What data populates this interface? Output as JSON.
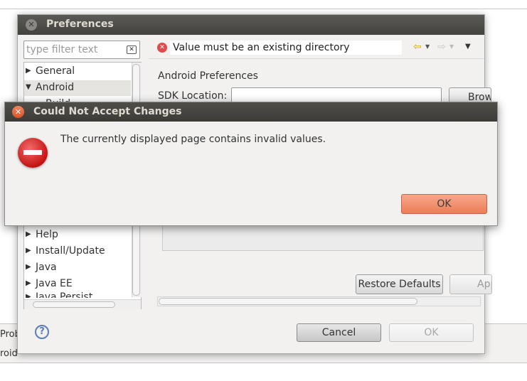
{
  "background": {
    "bottom_tab_1": "Prob",
    "bottom_tab_2": "roid"
  },
  "preferences": {
    "title": "Preferences",
    "filter_placeholder": "type filter text",
    "tree": [
      {
        "label": "General",
        "expanded": false
      },
      {
        "label": "Android",
        "expanded": true,
        "selected": true
      },
      {
        "label": "Build",
        "expanded": false
      },
      {
        "label": "Help",
        "expanded": false
      },
      {
        "label": "Install/Update",
        "expanded": false
      },
      {
        "label": "Java",
        "expanded": false
      },
      {
        "label": "Java EE",
        "expanded": false
      },
      {
        "label": "Java Persist",
        "expanded": false
      }
    ],
    "message": "Value must be an existing directory",
    "page_title": "Android Preferences",
    "sdk_location_label": "SDK Location:",
    "sdk_location_value": "",
    "browse_label": "Browse...",
    "restore_defaults_label": "Restore Defaults",
    "apply_label": "Apply",
    "cancel_label": "Cancel",
    "ok_label": "OK"
  },
  "error_dialog": {
    "title": "Could Not Accept Changes",
    "message": "The currently displayed page contains invalid values.",
    "ok_label": "OK"
  },
  "colors": {
    "titlebar": "#43423e",
    "error_red": "#df4a4a",
    "ok_accent": "#ec7e58"
  }
}
